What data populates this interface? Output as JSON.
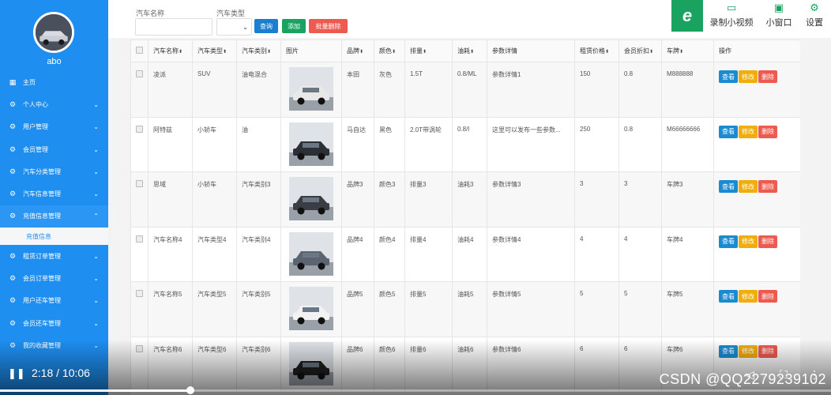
{
  "sidebar": {
    "username": "abo",
    "items": [
      {
        "label": "主页",
        "icon": "home-icon",
        "glyph": "▦",
        "chevron": ""
      },
      {
        "label": "个人中心",
        "icon": "settings-icon",
        "glyph": "⚙",
        "chevron": "⌄"
      },
      {
        "label": "用户管理",
        "icon": "settings-icon",
        "glyph": "⚙",
        "chevron": "⌄"
      },
      {
        "label": "会员管理",
        "icon": "settings-icon",
        "glyph": "⚙",
        "chevron": "⌄"
      },
      {
        "label": "汽车分类管理",
        "icon": "settings-icon",
        "glyph": "⚙",
        "chevron": "⌄"
      },
      {
        "label": "汽车信息管理",
        "icon": "settings-icon",
        "glyph": "⚙",
        "chevron": "⌄"
      },
      {
        "label": "充值信息管理",
        "icon": "settings-icon",
        "glyph": "⚙",
        "chevron": "⌃"
      },
      {
        "label": "租赁订单管理",
        "icon": "settings-icon",
        "glyph": "⚙",
        "chevron": "⌄"
      },
      {
        "label": "会员订单管理",
        "icon": "settings-icon",
        "glyph": "⚙",
        "chevron": "⌄"
      },
      {
        "label": "用户还车管理",
        "icon": "settings-icon",
        "glyph": "⚙",
        "chevron": "⌄"
      },
      {
        "label": "会员还车管理",
        "icon": "settings-icon",
        "glyph": "⚙",
        "chevron": "⌄"
      },
      {
        "label": "我的收藏管理",
        "icon": "settings-icon",
        "glyph": "⚙",
        "chevron": "⌄"
      }
    ],
    "submenu_label": "充值信息"
  },
  "toolbar": {
    "name_label": "汽车名称",
    "name_value": "",
    "type_label": "汽车类型",
    "type_value": "",
    "query_label": "查询",
    "add_label": "添加",
    "batch_delete_label": "批量删除",
    "record_label": "录制小视频",
    "window_label": "小窗口",
    "settings_label": "设置"
  },
  "table": {
    "headers": [
      "",
      "汽车名称",
      "汽车类型",
      "汽车类别",
      "图片",
      "品牌",
      "颜色",
      "排量",
      "油耗",
      "参数详情",
      "租赁价格",
      "会员折扣",
      "车牌",
      "操作"
    ],
    "rows": [
      {
        "name": "凌派",
        "type": "SUV",
        "category": "油电混合",
        "brand": "本田",
        "color": "灰色",
        "displacement": "1.5T",
        "fuel": "0.8/ML",
        "detail": "参数详情1",
        "price": "150",
        "discount": "0.8",
        "plate": "M888888",
        "car_color": "#e8e8e8"
      },
      {
        "name": "阿特兹",
        "type": "小轿车",
        "category": "油",
        "brand": "马自达",
        "color": "黑色",
        "displacement": "2.0T带涡轮",
        "fuel": "0.8/l",
        "detail": "这里可以发布一些参数...",
        "price": "250",
        "discount": "0.8",
        "plate": "M66666666",
        "car_color": "#2b2f36"
      },
      {
        "name": "思域",
        "type": "小轿车",
        "category": "汽车类别3",
        "brand": "品牌3",
        "color": "颜色3",
        "displacement": "排量3",
        "fuel": "油耗3",
        "detail": "参数详情3",
        "price": "3",
        "discount": "3",
        "plate": "车牌3",
        "car_color": "#3a3d44"
      },
      {
        "name": "汽车名称4",
        "type": "汽车类型4",
        "category": "汽车类别4",
        "brand": "品牌4",
        "color": "颜色4",
        "displacement": "排量4",
        "fuel": "油耗4",
        "detail": "参数详情4",
        "price": "4",
        "discount": "4",
        "plate": "车牌4",
        "car_color": "#5b6470"
      },
      {
        "name": "汽车名称5",
        "type": "汽车类型5",
        "category": "汽车类别5",
        "brand": "品牌5",
        "color": "颜色5",
        "displacement": "排量5",
        "fuel": "油耗5",
        "detail": "参数详情5",
        "price": "5",
        "discount": "5",
        "plate": "车牌5",
        "car_color": "#f2f2f2"
      },
      {
        "name": "汽车名称6",
        "type": "汽车类型6",
        "category": "汽车类别6",
        "brand": "品牌6",
        "color": "颜色6",
        "displacement": "排量6",
        "fuel": "油耗6",
        "detail": "参数详情6",
        "price": "6",
        "discount": "6",
        "plate": "车牌6",
        "car_color": "#1f1f1f"
      }
    ],
    "view_label": "查看",
    "edit_label": "修改",
    "delete_label": "删除"
  },
  "video": {
    "time": "2:18 / 10:06",
    "progress": 0.229,
    "watermark": "CSDN @QQ2279239102"
  },
  "colors": {
    "sidebar": "#1e8ff1",
    "query": "#1b7fd1",
    "add": "#1aa260",
    "batch_delete": "#ee5a4f"
  }
}
